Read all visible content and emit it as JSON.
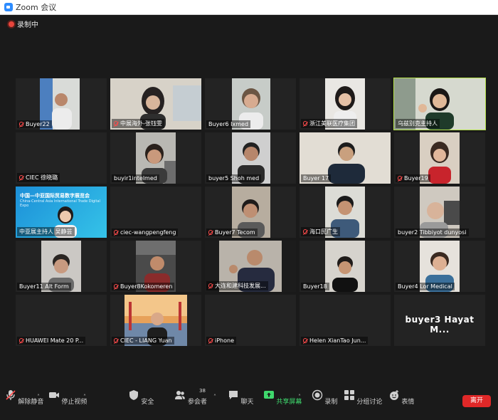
{
  "window": {
    "title": "Zoom 会议"
  },
  "recording": {
    "label": "录制中"
  },
  "tiles": [
    {
      "name": "Buyer22",
      "muted": true
    },
    {
      "name": "中展海外-张钰雯",
      "muted": true
    },
    {
      "name": "Buyer6 Ixmed",
      "muted": false
    },
    {
      "name": "浙江美联医疗集团",
      "muted": true
    },
    {
      "name": "乌兹别克主持人",
      "muted": false
    },
    {
      "name": "CIEC 徐晓璐",
      "muted": true
    },
    {
      "name": "buyir1intelmed",
      "muted": false
    },
    {
      "name": "buyer5 Shoh med",
      "muted": false
    },
    {
      "name": "Buyer 17",
      "muted": false
    },
    {
      "name": "Buyer19",
      "muted": true
    },
    {
      "name": "中亚展主持人 吴静芸",
      "muted": false
    },
    {
      "name": "ciec-wangpengfeng",
      "muted": true
    },
    {
      "name": "Buyer7 Tecom",
      "muted": true
    },
    {
      "name": "海口民广生",
      "muted": true
    },
    {
      "name": "buyer2 Tibbiyot dunyosi",
      "muted": false
    },
    {
      "name": "Buyer11 Alt Form",
      "muted": false
    },
    {
      "name": "Buyer8Kokomeren",
      "muted": true
    },
    {
      "name": "大连和建科技发展...",
      "muted": true
    },
    {
      "name": "Buyer18",
      "muted": false
    },
    {
      "name": "Buyer4 Lor Medical",
      "muted": false
    },
    {
      "name": "HUAWEI Mate 20 P...",
      "muted": true
    },
    {
      "name": "CIEC - LIANG Yuan",
      "muted": true
    },
    {
      "name": "iPhone",
      "muted": true
    },
    {
      "name": "Helen XianTao Jun...",
      "muted": true
    },
    {
      "name": "",
      "muted": false
    }
  ],
  "big_name": "buyer3 Hayat M...",
  "banner": {
    "line1": "中国—中亚国际贸易数字展览会",
    "line2": "China-Central Asia International Trade Digital Expo"
  },
  "toolbar": {
    "unmute": "解除静音",
    "stop_video": "停止视频",
    "security": "安全",
    "participants": "参会者",
    "participants_count": "38",
    "chat": "聊天",
    "share_screen": "共享屏幕",
    "record": "录制",
    "breakout": "分组讨论",
    "reactions": "表情",
    "leave": "离开"
  },
  "colors": {
    "active_speaker": "#b5e24a",
    "share_green": "#3fd86d",
    "leave_red": "#e02828"
  }
}
